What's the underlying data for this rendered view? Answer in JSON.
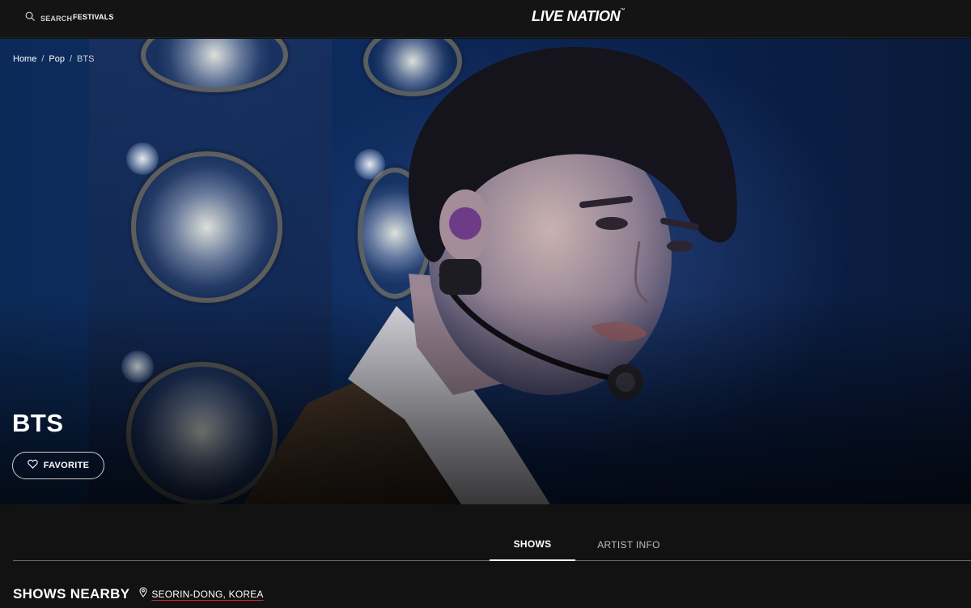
{
  "nav": {
    "search_label": "SEARCH",
    "festivals_label": "FESTIVALS",
    "logo_text": "LIVE NATION"
  },
  "breadcrumb": {
    "items": [
      "Home",
      "Pop",
      "BTS"
    ],
    "separator": "/"
  },
  "artist": {
    "name": "BTS",
    "favorite_label": "FAVORITE"
  },
  "tabs": [
    {
      "label": "SHOWS",
      "active": true
    },
    {
      "label": "ARTIST INFO",
      "active": false
    }
  ],
  "shows_nearby": {
    "heading": "SHOWS NEARBY",
    "location": "SEORIN-DONG, KOREA"
  },
  "colors": {
    "background": "#121212",
    "nav_background": "#141414",
    "location_underline": "#d6263a",
    "hero_blue": "#0d2f63"
  },
  "icons": {
    "search": "search-icon",
    "favorite": "heart-icon",
    "location": "map-pin-icon"
  }
}
